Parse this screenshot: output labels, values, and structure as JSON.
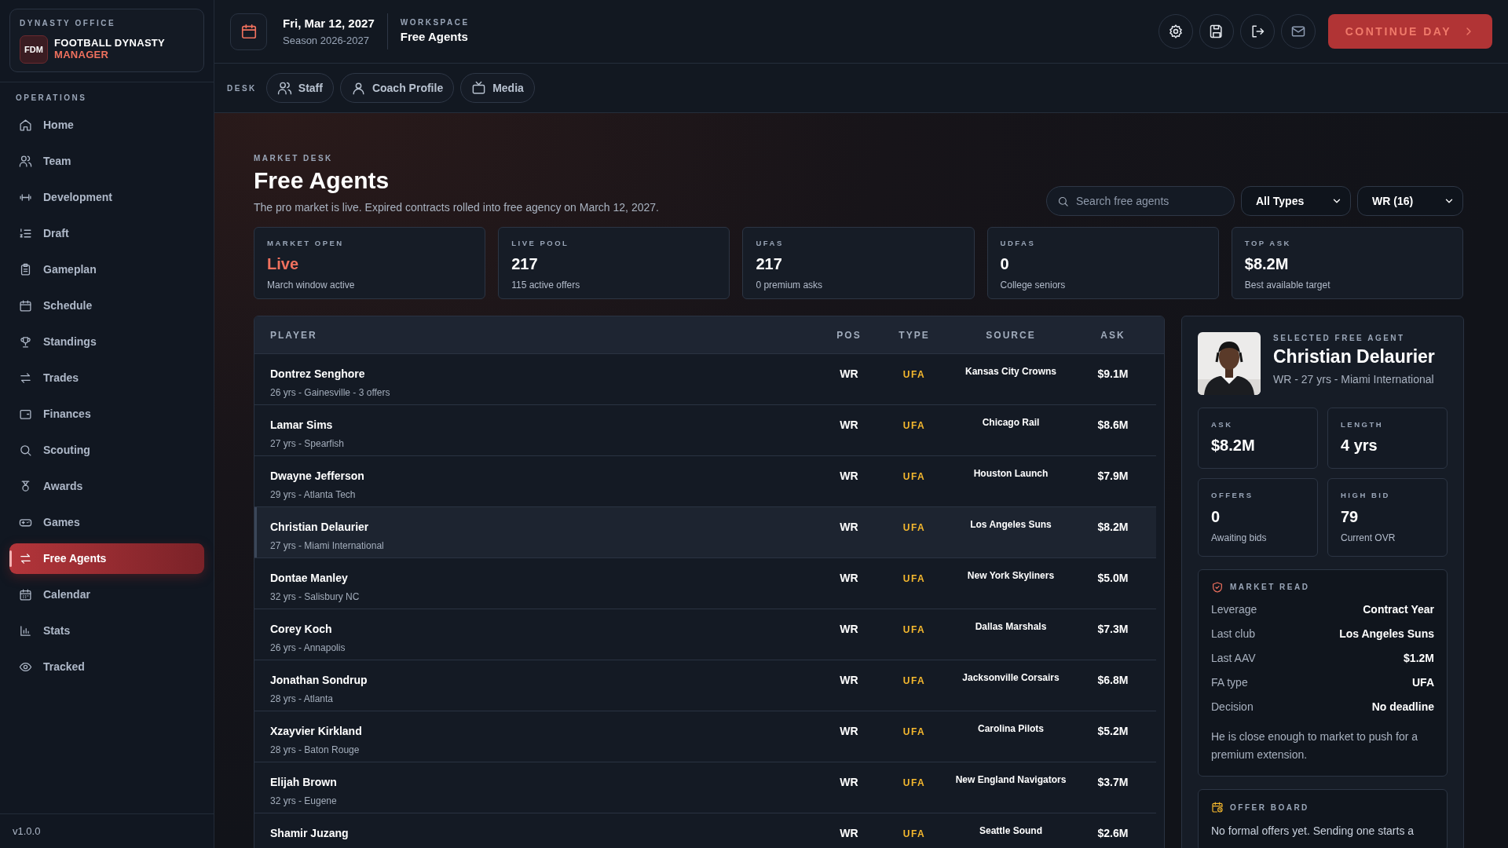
{
  "brand": {
    "eyebrow": "DYNASTY OFFICE",
    "logo": "FDM",
    "title": "FOOTBALL DYNASTY",
    "subtitle": "MANAGER"
  },
  "sidebar": {
    "section": "OPERATIONS",
    "items": [
      {
        "label": "Home",
        "selected": false
      },
      {
        "label": "Team",
        "selected": false
      },
      {
        "label": "Development",
        "selected": false
      },
      {
        "label": "Draft",
        "selected": false
      },
      {
        "label": "Gameplan",
        "selected": false
      },
      {
        "label": "Schedule",
        "selected": false
      },
      {
        "label": "Standings",
        "selected": false
      },
      {
        "label": "Trades",
        "selected": false
      },
      {
        "label": "Finances",
        "selected": false
      },
      {
        "label": "Scouting",
        "selected": false
      },
      {
        "label": "Awards",
        "selected": false
      },
      {
        "label": "Games",
        "selected": false
      },
      {
        "label": "Free Agents",
        "selected": true
      },
      {
        "label": "Calendar",
        "selected": false
      },
      {
        "label": "Stats",
        "selected": false
      },
      {
        "label": "Tracked",
        "selected": false
      }
    ],
    "version": "v1.0.0"
  },
  "header": {
    "date": "Fri, Mar 12, 2027",
    "season": "Season 2026-2027",
    "workspace_label": "WORKSPACE",
    "workspace": "Free Agents",
    "continue_button": "CONTINUE DAY"
  },
  "desk": {
    "label": "DESK",
    "buttons": [
      "Staff",
      "Coach Profile",
      "Media"
    ]
  },
  "page": {
    "eyebrow": "MARKET DESK",
    "title": "Free Agents",
    "subtitle": "The pro market is live. Expired contracts rolled into free agency on March 12, 2027.",
    "search": {
      "placeholder": "Search free agents"
    },
    "filters": [
      "All Types",
      "WR (16)"
    ]
  },
  "stats": [
    {
      "label": "MARKET OPEN",
      "value": "Live",
      "note": "March window active",
      "kind": "alert"
    },
    {
      "label": "LIVE POOL",
      "value": "217",
      "note": "115 active offers",
      "kind": "plain"
    },
    {
      "label": "UFAS",
      "value": "217",
      "note": "0 premium asks",
      "kind": "plain"
    },
    {
      "label": "UDFAS",
      "value": "0",
      "note": "College seniors",
      "kind": "plain"
    },
    {
      "label": "TOP ASK",
      "value": "$8.2M",
      "note": "Best available target",
      "kind": "plain"
    }
  ],
  "table": {
    "columns": [
      "PLAYER",
      "POS",
      "TYPE",
      "SOURCE",
      "ASK"
    ],
    "rows": [
      {
        "name": "Dontrez Senghore",
        "details": "26 yrs - Gainesville - 3 offers",
        "pos": "WR",
        "type": "UFA",
        "source": "Kansas City Crowns",
        "ask": "$9.1M",
        "selected": false
      },
      {
        "name": "Lamar Sims",
        "details": "27 yrs - Spearfish",
        "pos": "WR",
        "type": "UFA",
        "source": "Chicago Rail",
        "ask": "$8.6M",
        "selected": false
      },
      {
        "name": "Dwayne Jefferson",
        "details": "29 yrs - Atlanta Tech",
        "pos": "WR",
        "type": "UFA",
        "source": "Houston Launch",
        "ask": "$7.9M",
        "selected": false
      },
      {
        "name": "Christian Delaurier",
        "details": "27 yrs - Miami International",
        "pos": "WR",
        "type": "UFA",
        "source": "Los Angeles Suns",
        "ask": "$8.2M",
        "selected": true
      },
      {
        "name": "Dontae Manley",
        "details": "32 yrs - Salisbury NC",
        "pos": "WR",
        "type": "UFA",
        "source": "New York Skyliners",
        "ask": "$5.0M",
        "selected": false
      },
      {
        "name": "Corey Koch",
        "details": "26 yrs - Annapolis",
        "pos": "WR",
        "type": "UFA",
        "source": "Dallas Marshals",
        "ask": "$7.3M",
        "selected": false
      },
      {
        "name": "Jonathan Sondrup",
        "details": "28 yrs - Atlanta",
        "pos": "WR",
        "type": "UFA",
        "source": "Jacksonville Corsairs",
        "ask": "$6.8M",
        "selected": false
      },
      {
        "name": "Xzayvier Kirkland",
        "details": "28 yrs - Baton Rouge",
        "pos": "WR",
        "type": "UFA",
        "source": "Carolina Pilots",
        "ask": "$5.2M",
        "selected": false
      },
      {
        "name": "Elijah Brown",
        "details": "32 yrs - Eugene",
        "pos": "WR",
        "type": "UFA",
        "source": "New England Navigators",
        "ask": "$3.7M",
        "selected": false
      },
      {
        "name": "Shamir Juzang",
        "pos": "WR",
        "type": "UFA",
        "source": "Seattle Sound",
        "ask": "$2.6M",
        "selected": false
      }
    ]
  },
  "detail": {
    "eyebrow": "SELECTED FREE AGENT",
    "name": "Christian Delaurier",
    "summary": "WR - 27 yrs - Miami International",
    "metrics": [
      {
        "label": "ASK",
        "value": "$8.2M"
      },
      {
        "label": "LENGTH",
        "value": "4 yrs"
      },
      {
        "label": "OFFERS",
        "value": "0",
        "note": "Awaiting bids"
      },
      {
        "label": "HIGH BID",
        "value": "79",
        "note": "Current OVR"
      }
    ],
    "market_read": {
      "title": "MARKET READ",
      "rows": [
        {
          "label": "Leverage",
          "value": "Contract Year"
        },
        {
          "label": "Last club",
          "value": "Los Angeles Suns"
        },
        {
          "label": "Last AAV",
          "value": "$1.2M"
        },
        {
          "label": "FA type",
          "value": "UFA"
        },
        {
          "label": "Decision",
          "value": "No deadline"
        }
      ],
      "note": "He is close enough to market to push for a premium extension."
    },
    "offer_board": {
      "title": "OFFER BOARD",
      "text": "No formal offers yet. Sending one starts a"
    }
  }
}
